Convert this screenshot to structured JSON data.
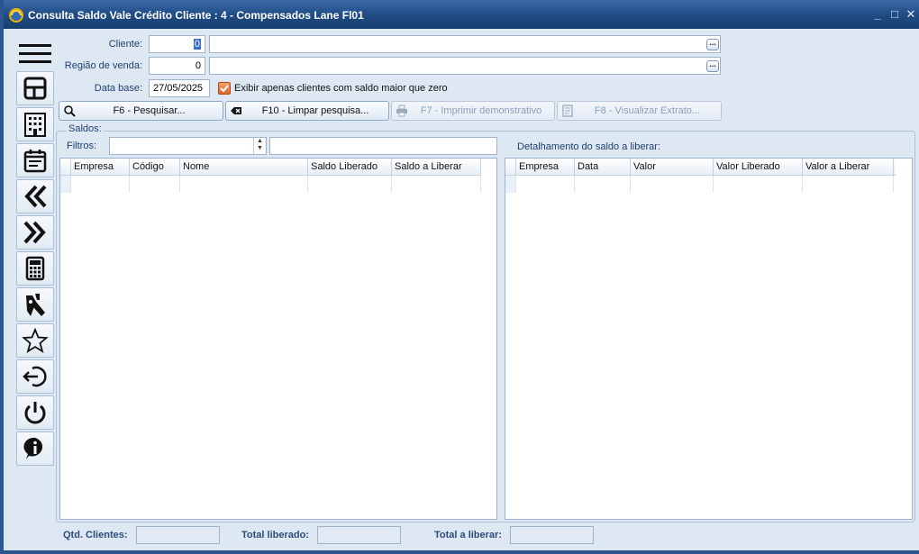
{
  "window": {
    "title": "Consulta Saldo Vale Crédito Cliente : 4 - Compensados Lane Fl01",
    "controls": {
      "minimize": "_",
      "maximize": "□",
      "close": "✕"
    }
  },
  "sidebar": {
    "items": [
      {
        "icon": "layout-icon"
      },
      {
        "icon": "building-icon"
      },
      {
        "icon": "calendar-icon"
      },
      {
        "icon": "double-chevron-left-icon"
      },
      {
        "icon": "double-chevron-right-icon"
      },
      {
        "icon": "calculator-icon"
      },
      {
        "icon": "tools-icon"
      },
      {
        "icon": "star-icon"
      },
      {
        "icon": "logout-icon"
      },
      {
        "icon": "power-icon"
      },
      {
        "icon": "info-icon"
      }
    ]
  },
  "form": {
    "cliente": {
      "label": "Cliente:",
      "code": "0",
      "name": ""
    },
    "regiao": {
      "label": "Região de venda:",
      "code": "0",
      "name": ""
    },
    "data_base": {
      "label": "Data base:",
      "value": "27/05/2025"
    },
    "exibir_saldo": {
      "label": "Exibir apenas clientes com saldo maior que zero",
      "checked": true
    },
    "ellipsis": "..."
  },
  "toolbar": {
    "pesquisar": "F6 - Pesquisar...",
    "limpar": "F10 - Limpar pesquisa...",
    "imprimir": "F7 - Imprimir demonstrativo",
    "extrato": "F8 - Visualizar Extrato..."
  },
  "saldos": {
    "group_label": "Saldos:",
    "filtros_label": "Filtros:",
    "filtro_value": "",
    "filtro_text": "",
    "columns": [
      "Empresa",
      "Código",
      "Nome",
      "Saldo Liberado",
      "Saldo a Liberar"
    ]
  },
  "detalhamento": {
    "label": "Detalhamento do saldo a liberar:",
    "columns": [
      "Empresa",
      "Data",
      "Valor",
      "Valor Liberado",
      "Valor a Liberar"
    ]
  },
  "footer": {
    "qtd_clientes": {
      "label": "Qtd. Clientes:",
      "value": ""
    },
    "total_liberado": {
      "label": "Total liberado:",
      "value": ""
    },
    "total_a_liberar": {
      "label": "Total a liberar:",
      "value": ""
    }
  }
}
